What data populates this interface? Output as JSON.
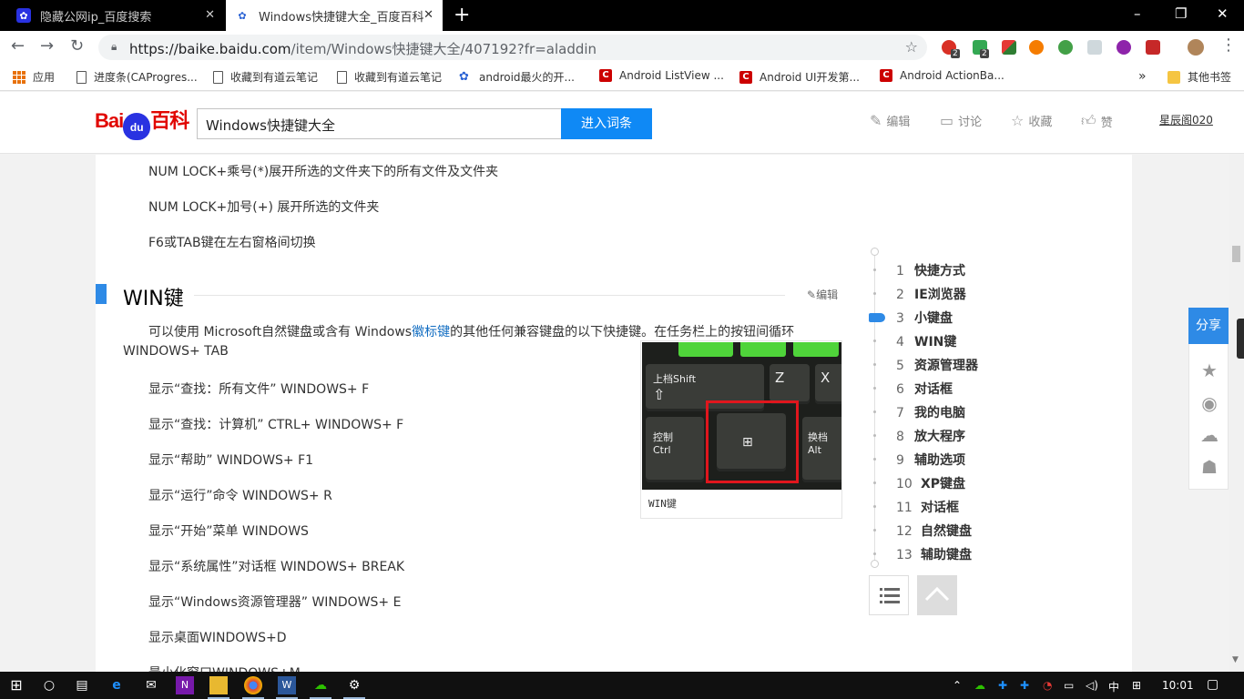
{
  "tabs": [
    {
      "title": "隐藏公网ip_百度搜索",
      "active": false
    },
    {
      "title": "Windows快捷键大全_百度百科",
      "active": true
    }
  ],
  "toolbar": {
    "url_host": "https://baike.baidu.com",
    "url_path": "/item/Windows快捷键大全/407192?fr=aladdin",
    "ext_badges": [
      "2",
      "2"
    ]
  },
  "bookmarks": [
    {
      "label": "应用",
      "icon": "apps-icon"
    },
    {
      "label": "进度条(CAProgres...",
      "icon": "document-icon"
    },
    {
      "label": "收藏到有道云笔记",
      "icon": "document-icon"
    },
    {
      "label": "收藏到有道云笔记",
      "icon": "document-icon"
    },
    {
      "label": "android最火的开...",
      "icon": "baidu-paw-icon"
    },
    {
      "label": "Android ListView ...",
      "icon": "csdn-icon"
    },
    {
      "label": "Android UI开发第...",
      "icon": "csdn-icon"
    },
    {
      "label": "Android ActionBa...",
      "icon": "csdn-icon"
    },
    {
      "label": "其他书签",
      "icon": "folder-icon"
    }
  ],
  "header": {
    "logo_text": "Bai",
    "logo_paw": "du",
    "logo_suffix": "百科",
    "search_value": "Windows快捷键大全",
    "search_button": "进入词条",
    "actions": [
      "编辑",
      "讨论",
      "收藏",
      "赞"
    ],
    "user": "星辰阁020"
  },
  "content": {
    "top_lines": [
      "NUM LOCK+乘号(*)展开所选的文件夹下的所有文件及文件夹",
      "NUM LOCK+加号(+) 展开所选的文件夹",
      "F6或TAB键在左右窗格间切换"
    ],
    "section_title": "WIN键",
    "section_edit": "编辑",
    "intro_before": "可以使用 Microsoft自然键盘或含有 Windows",
    "intro_link": "徽标键",
    "intro_after": "的其他任何兼容键盘的以下快捷键。在任务栏上的按钮间循环",
    "intro_line2": "WINDOWS+ TAB",
    "items": [
      "显示“查找：所有文件” WINDOWS+ F",
      "显示“查找：计算机” CTRL+ WINDOWS+ F",
      "显示“帮助” WINDOWS+ F1",
      "显示“运行”命令 WINDOWS+ R",
      "显示“开始”菜单 WINDOWS",
      "显示“系统属性”对话框 WINDOWS+ BREAK",
      "显示“Windows资源管理器” WINDOWS+ E",
      "显示桌面WINDOWS+D",
      "最小化窗口WINDOWS+M"
    ],
    "figure_caption": "WIN键",
    "figure_keys": {
      "shift": "上档Shift",
      "z": "Z",
      "x": "X",
      "ctrl": "控制\nCtrl",
      "alt": "换档\nAlt"
    }
  },
  "catalog": [
    {
      "num": "1",
      "label": "快捷方式"
    },
    {
      "num": "2",
      "label": "IE浏览器"
    },
    {
      "num": "3",
      "label": "小键盘"
    },
    {
      "num": "4",
      "label": "WIN键"
    },
    {
      "num": "5",
      "label": "资源管理器"
    },
    {
      "num": "6",
      "label": "对话框"
    },
    {
      "num": "7",
      "label": "我的电脑"
    },
    {
      "num": "8",
      "label": "放大程序"
    },
    {
      "num": "9",
      "label": "辅助选项"
    },
    {
      "num": "10",
      "label": "XP键盘"
    },
    {
      "num": "11",
      "label": "对话框"
    },
    {
      "num": "12",
      "label": "自然键盘"
    },
    {
      "num": "13",
      "label": "辅助键盘"
    }
  ],
  "catalog_current": 3,
  "share": {
    "title": "分享"
  },
  "taskbar": {
    "time": "10:01",
    "ime": "中"
  },
  "colors": {
    "accent": "#2e8ae6",
    "search_button": "#0f89f5",
    "logo_red": "#e10601",
    "logo_blue": "#2932e1",
    "link": "#136ec2"
  }
}
